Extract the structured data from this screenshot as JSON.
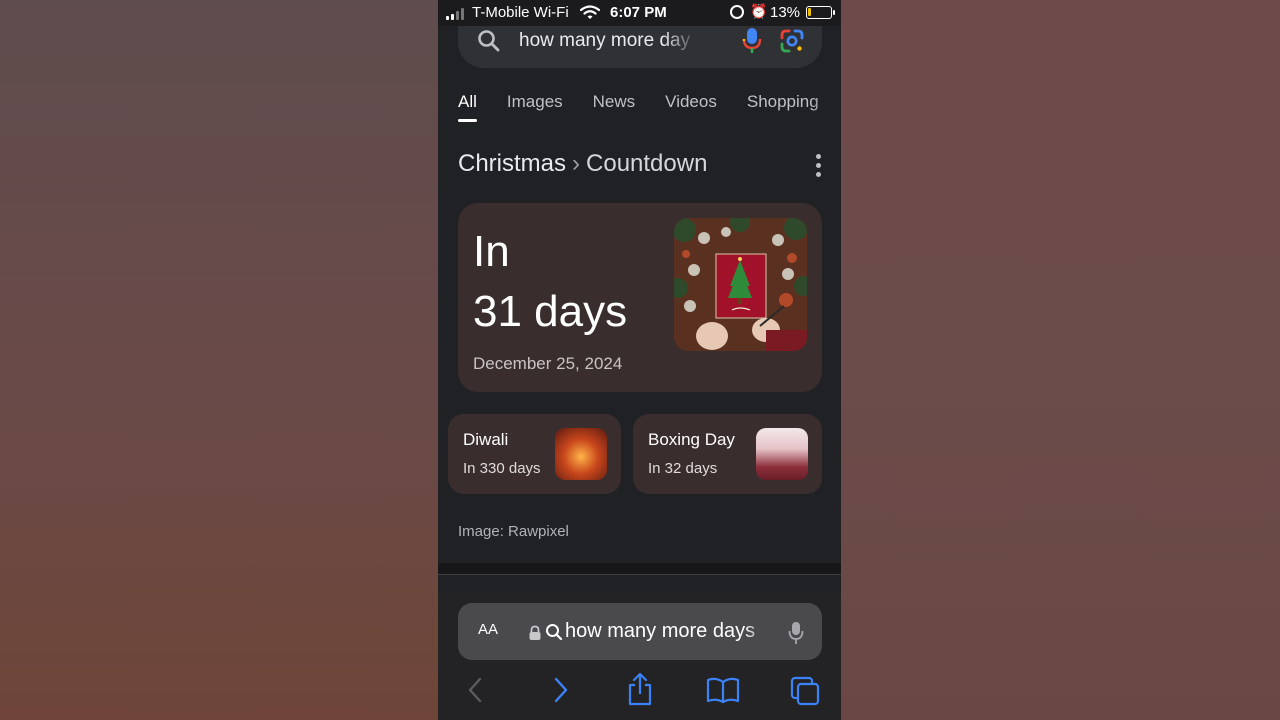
{
  "status_bar": {
    "carrier": "T-Mobile Wi-Fi",
    "time": "6:07 PM",
    "battery": "13%",
    "battery_level": 0.13,
    "icons": [
      "signal-icon",
      "wifi-icon",
      "orientation-lock-icon",
      "alarm-icon",
      "battery-icon"
    ]
  },
  "search": {
    "query": "how many more day",
    "icons": [
      "search-icon",
      "microphone-icon",
      "google-lens-icon"
    ]
  },
  "tabs": [
    {
      "label": "All",
      "active": true
    },
    {
      "label": "Images",
      "active": false
    },
    {
      "label": "News",
      "active": false
    },
    {
      "label": "Videos",
      "active": false
    },
    {
      "label": "Shopping",
      "active": false
    }
  ],
  "heading": {
    "topic": "Christmas",
    "separator": "›",
    "subtopic": "Countdown"
  },
  "countdown": {
    "prefix": "In",
    "days": "31 days",
    "date": "December 25, 2024"
  },
  "related": [
    {
      "title": "Diwali",
      "subtitle": "In 330 days"
    },
    {
      "title": "Boxing Day",
      "subtitle": "In 32 days"
    }
  ],
  "image_credit": "Image: Rawpixel",
  "safari": {
    "text_size_label": "AA",
    "url_text": "how many more days",
    "toolbar": [
      "back-icon",
      "forward-icon",
      "share-icon",
      "bookmarks-icon",
      "tabs-icon"
    ]
  },
  "colors": {
    "page_bg": "#202124",
    "card_bg": "#3a2d2d",
    "accent_blue": "#3b82f6"
  }
}
